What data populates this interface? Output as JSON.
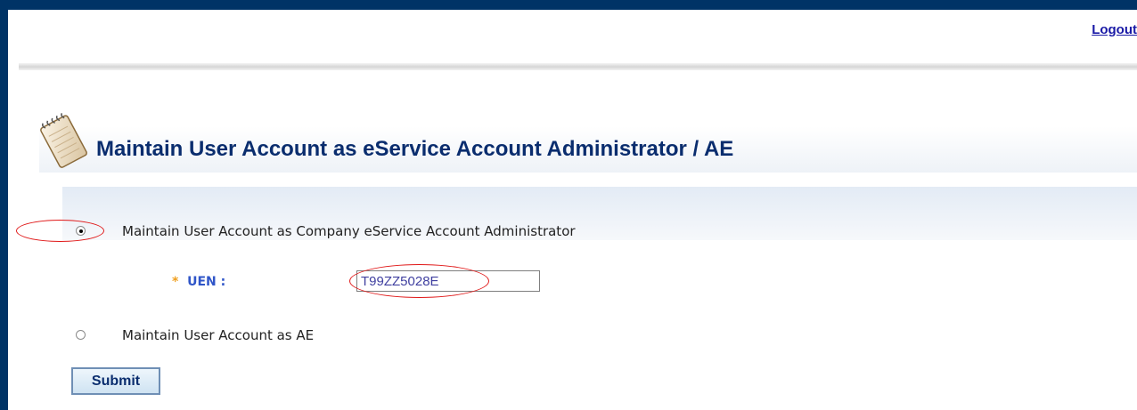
{
  "header": {
    "logout_label": "Logout"
  },
  "page": {
    "title": "Maintain User Account as eService Account Administrator / AE",
    "icon": "notepad-icon"
  },
  "form": {
    "options": [
      {
        "label": "Maintain User Account as Company eService Account Administrator",
        "selected": true
      },
      {
        "label": "Maintain User Account as AE",
        "selected": false
      }
    ],
    "uen": {
      "required_marker": "*",
      "label": "UEN :",
      "value": "T99ZZ5028E"
    },
    "submit_label": "Submit"
  },
  "colors": {
    "frame": "#003366",
    "title": "#0a2d6e",
    "link": "#1a1aa6",
    "uen_label": "#2f55c8",
    "required": "#f0a020",
    "annotation": "#e01818"
  }
}
